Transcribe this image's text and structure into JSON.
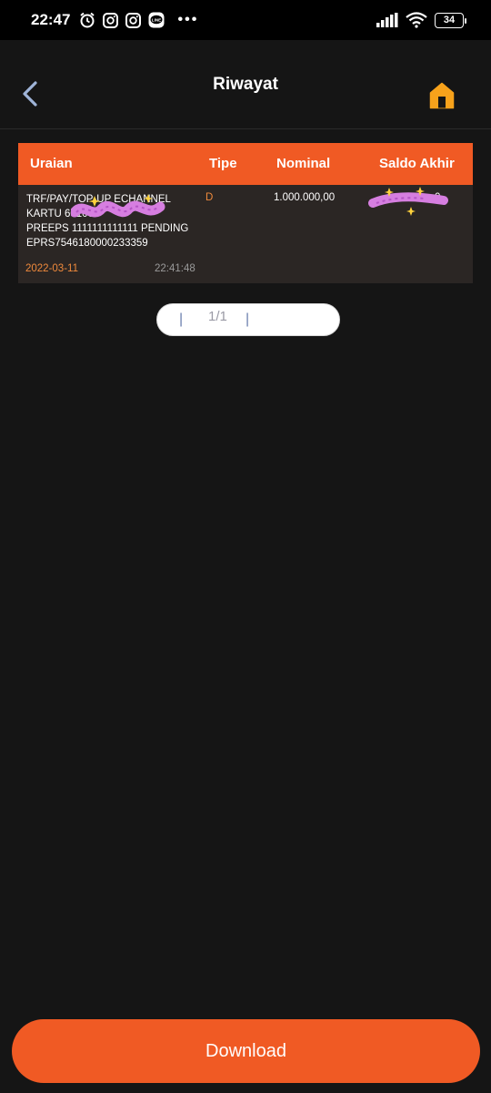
{
  "status_bar": {
    "time": "22:47",
    "dots": "•••",
    "battery": "34"
  },
  "header": {
    "title": "Riwayat",
    "back_icon": "chevron-left-icon",
    "home_icon": "home-icon"
  },
  "table": {
    "columns": [
      "Uraian",
      "Tipe",
      "Nominal",
      "Saldo Akhir"
    ],
    "rows": [
      {
        "uraian": "TRF/PAY/TOP-UP ECHANNEL\nKARTU 601000\nPREEPS 1111111111111 PENDING\nEPRS7546180000233359",
        "tipe": "D",
        "nominal": "1.000.000,00",
        "saldo_akhir": "0",
        "date": "2022-03-11",
        "time": "22:41:48"
      }
    ]
  },
  "pagination": {
    "bar_left": "|",
    "page": "1/1",
    "bar_right": "|"
  },
  "download_label": "Download",
  "colors": {
    "accent": "#f05a24",
    "background": "#151515",
    "row_bg": "#2b2624",
    "home_icon": "#f7a21b"
  }
}
